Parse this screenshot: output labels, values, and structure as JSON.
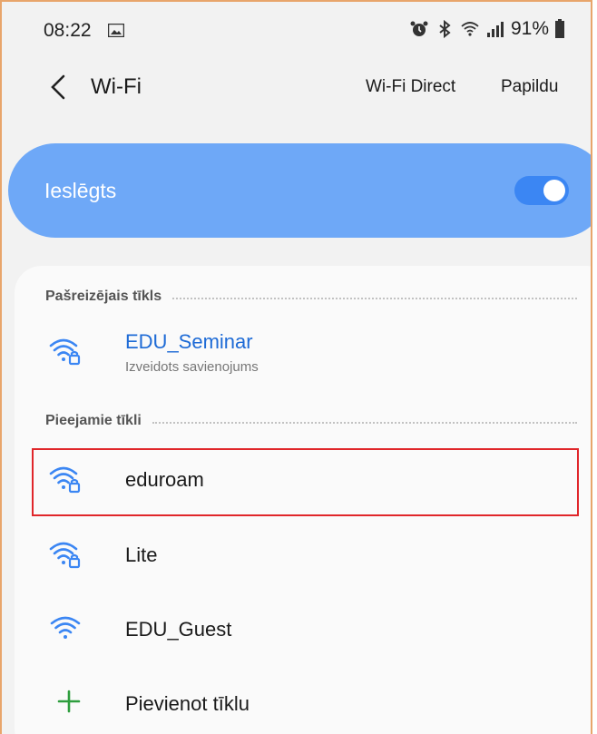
{
  "status_bar": {
    "time": "08:22",
    "battery": "91%",
    "icons": [
      "gallery-icon",
      "alarm-icon",
      "bluetooth-icon",
      "wifi-status-icon",
      "signal-icon",
      "battery-icon"
    ]
  },
  "header": {
    "title": "Wi-Fi",
    "actions": {
      "wifi_direct": "Wi-Fi Direct",
      "more": "Papildu"
    }
  },
  "wifi_toggle": {
    "label": "Ieslēgts",
    "state": "on"
  },
  "sections": {
    "current_label": "Pašreizējais tīkls",
    "available_label": "Pieejamie tīkli"
  },
  "current_network": {
    "name": "EDU_Seminar",
    "status": "Izveidots savienojums",
    "secured": true
  },
  "networks": [
    {
      "name": "eduroam",
      "secured": true
    },
    {
      "name": "Lite",
      "secured": true
    },
    {
      "name": "EDU_Guest",
      "secured": false
    }
  ],
  "add_network": {
    "label": "Pievienot tīklu"
  },
  "colors": {
    "accent": "#3b86f3",
    "toggle_card": "#6ea8f7",
    "current_network_text": "#1e6bd6",
    "highlight": "#e0262a",
    "add_icon": "#2e9e3e"
  }
}
